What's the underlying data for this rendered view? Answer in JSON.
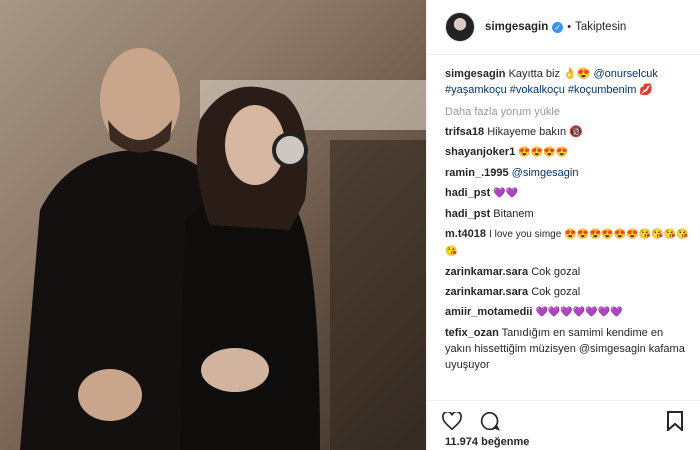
{
  "header": {
    "username": "simgesagin",
    "follow_label": "Takiptesin",
    "dot": "•"
  },
  "caption": {
    "username": "simgesagin",
    "text": "Kayıtta biz 👌😍",
    "mention": "@onurselcuk",
    "hashtags": "#yaşamkoçu #vokalkoçu #koçumbenim 💋"
  },
  "load_more": "Daha fazla yorum yükle",
  "comments": [
    {
      "user": "trifsa18",
      "text": "Hikayeme bakın 🔞"
    },
    {
      "user": "shayanjoker1",
      "text": "😍😍😍😍"
    },
    {
      "user": "ramin_.1995",
      "text": "@simgesagin"
    },
    {
      "user": "hadi_pst",
      "text": "💜💜"
    },
    {
      "user": "hadi_pst",
      "text": "Bitanem"
    },
    {
      "user": "m.t4018",
      "text": "I love you simge 😍😍😍😍😍😍😘😘😘😘😘"
    },
    {
      "user": "zarinkamar.sara",
      "text": "Cok gozal"
    },
    {
      "user": "zarinkamar.sara",
      "text": "Cok gozal"
    },
    {
      "user": "amiir_motamedii",
      "text": "💜💜💜💜💜💜💜"
    },
    {
      "user": "tefix_ozan",
      "text": "Tanıdığım en samimi kendime en yakın hissettiğim müzisyen @simgesagin kafama uyuşuyor"
    }
  ],
  "likes": "11.974 beğenme",
  "icons": {
    "like": "heart-icon",
    "comment": "comment-icon",
    "save": "bookmark-icon",
    "verified": "verified-badge-icon"
  },
  "colors": {
    "link": "#003569",
    "verified": "#3897f0",
    "muted": "#999999"
  }
}
